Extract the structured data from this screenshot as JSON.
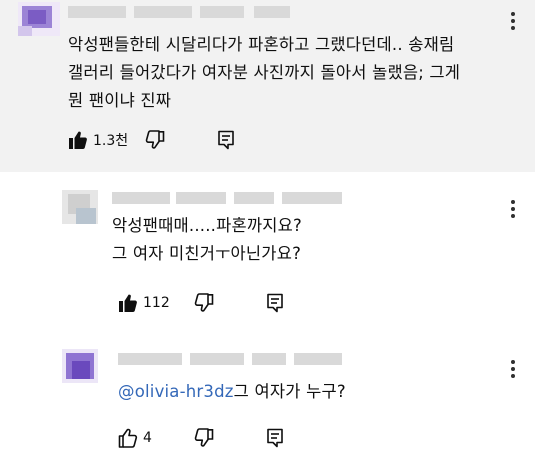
{
  "comments": [
    {
      "text_lines": [
        "악성팬들한테 시달리다가 파혼하고 그랬다던데.. 송재림",
        "갤러리 들어갔다가 여자분 사진까지 돌아서 놀랬음; 그게",
        "뭔 팬이냐 진짜"
      ],
      "like_count": "1.3천",
      "liked": true,
      "highlighted": true
    },
    {
      "text_lines": [
        "악성팬때매.....파혼까지요?",
        "그 여자 미친거ㅜ아닌가요?"
      ],
      "like_count": "112",
      "liked": true,
      "highlighted": false
    },
    {
      "mention": "@olivia-hr3dz",
      "text_after_mention": "그 여자가 누구?",
      "like_count": "4",
      "liked": false,
      "highlighted": false
    }
  ],
  "icons": {
    "like": "thumbs-up-icon",
    "dislike": "thumbs-down-icon",
    "reply": "reply-icon",
    "menu": "more-vert-icon"
  },
  "colors": {
    "highlight_bg": "#f2f2f2",
    "mention": "#3468b8",
    "avatar_purple": "#7b5cc4",
    "text": "#0f0f0f"
  }
}
